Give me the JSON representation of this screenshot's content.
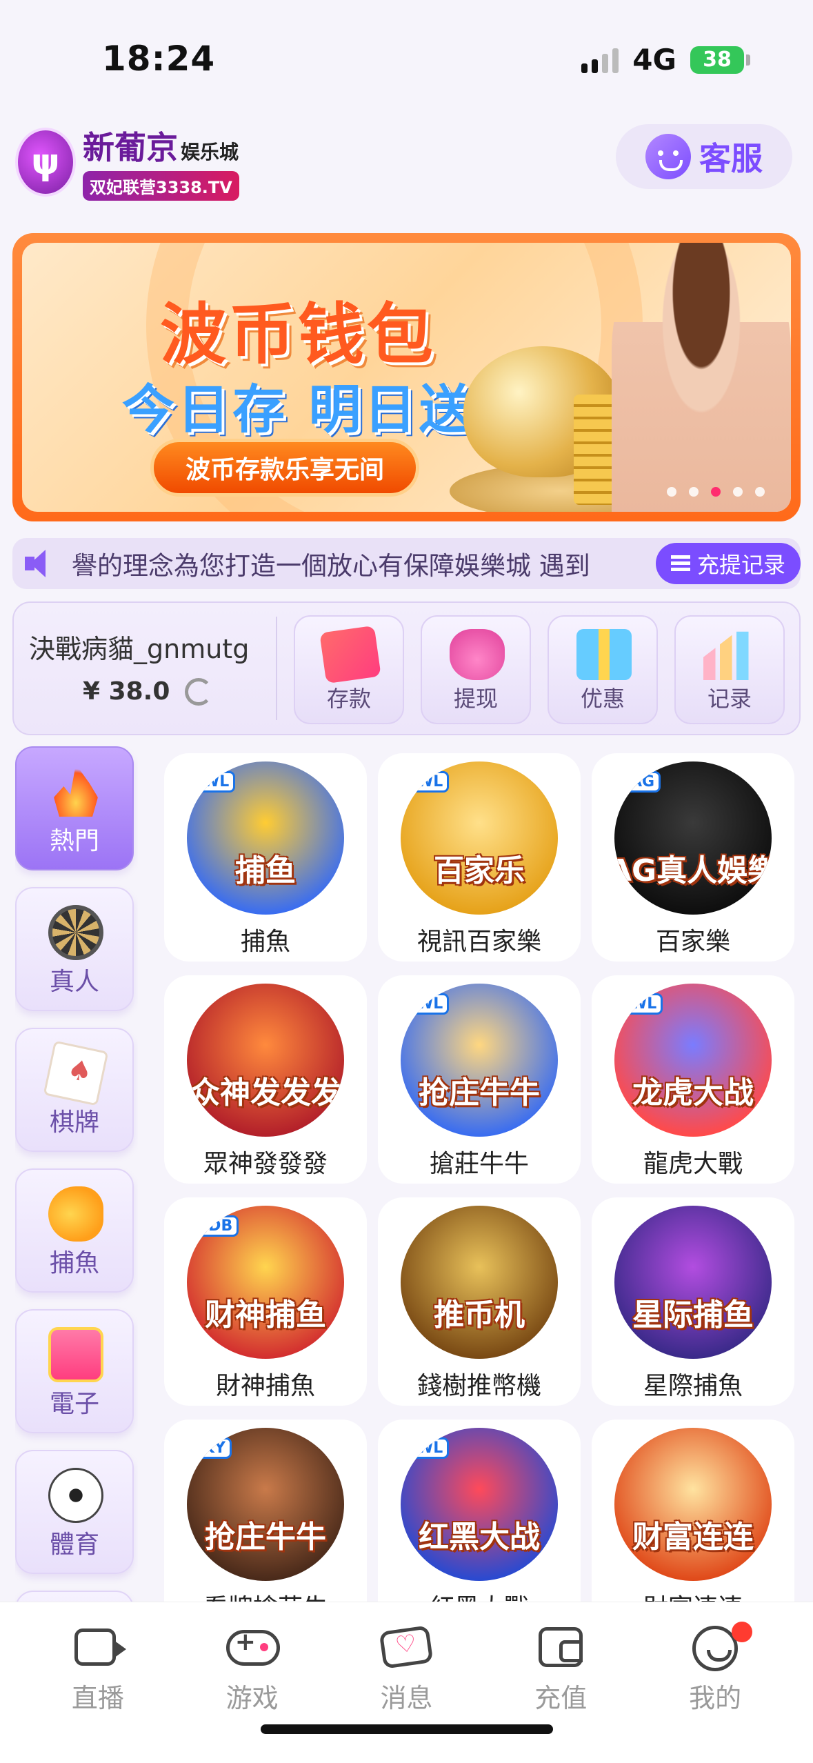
{
  "status_bar": {
    "time": "18:24",
    "network": "4G",
    "battery": "38"
  },
  "header": {
    "logo_name": "新葡京",
    "logo_sub": "娱乐城",
    "logo_badge": "双妃联营3338.TV",
    "service_label": "客服",
    "service_icon": "headset-icon"
  },
  "banner": {
    "title": "波币钱包",
    "subtitle": "今日存 明日送",
    "button": "波币存款乐享无间",
    "dots": 5,
    "active_dot": 3
  },
  "marquee": {
    "text": "譽的理念為您打造一個放心有保障娛樂城 遇到",
    "withdraw_log": "充提记录"
  },
  "account": {
    "username": "決戰病貓_gnmutg",
    "balance": "¥ 38.0",
    "actions": [
      {
        "label": "存款",
        "icon": "card-icon"
      },
      {
        "label": "提现",
        "icon": "money-bag-icon"
      },
      {
        "label": "优惠",
        "icon": "gift-icon"
      },
      {
        "label": "记录",
        "icon": "bar-chart-icon"
      }
    ]
  },
  "categories": [
    {
      "label": "熱門",
      "icon": "fire-icon",
      "active": true
    },
    {
      "label": "真人",
      "icon": "poker-chip-icon"
    },
    {
      "label": "棋牌",
      "icon": "playing-card-icon"
    },
    {
      "label": "捕魚",
      "icon": "fish-icon"
    },
    {
      "label": "電子",
      "icon": "slot-machine-icon"
    },
    {
      "label": "體育",
      "icon": "soccer-ball-icon"
    }
  ],
  "games": [
    {
      "label": "捕魚",
      "art": "捕鱼",
      "tag": "WL",
      "color1": "#ffcc33",
      "color2": "#3a6df0"
    },
    {
      "label": "視訊百家樂",
      "art": "百家乐",
      "tag": "WL",
      "color1": "#ffe08a",
      "color2": "#e6a21a"
    },
    {
      "label": "百家樂",
      "art": "AG真人娛樂",
      "tag": "AG",
      "color1": "#3a3a3a",
      "color2": "#0e0e0e"
    },
    {
      "label": "眾神發發發",
      "art": "众神发发发",
      "tag": "",
      "color1": "#ff8a3d",
      "color2": "#b3202a"
    },
    {
      "label": "搶莊牛牛",
      "art": "抢庄牛牛",
      "tag": "WL",
      "color1": "#ffd780",
      "color2": "#3a6df0"
    },
    {
      "label": "龍虎大戰",
      "art": "龙虎大战",
      "tag": "WL",
      "color1": "#7a7cff",
      "color2": "#ff4a4a"
    },
    {
      "label": "財神捕魚",
      "art": "财神捕鱼",
      "tag": "JDB",
      "color1": "#ffd54f",
      "color2": "#d32f2f"
    },
    {
      "label": "錢樹推幣機",
      "art": "推币机",
      "tag": "",
      "color1": "#e8c15a",
      "color2": "#7a4a14"
    },
    {
      "label": "星際捕魚",
      "art": "星际捕鱼",
      "tag": "",
      "color1": "#b24de0",
      "color2": "#3b2a8a"
    },
    {
      "label": "看牌搶莊牛",
      "art": "抢庄牛牛",
      "tag": "KY",
      "color1": "#c97a4a",
      "color2": "#4a2a1a"
    },
    {
      "label": "紅黑大戰",
      "art": "红黑大战",
      "tag": "WL",
      "color1": "#ff4a5a",
      "color2": "#2a4ad0"
    },
    {
      "label": "財富連連",
      "art": "财富连连",
      "tag": "",
      "color1": "#ffe3a0",
      "color2": "#e04a1a"
    }
  ],
  "tabbar": [
    {
      "label": "直播",
      "icon": "live-camera-icon"
    },
    {
      "label": "游戏",
      "icon": "gamepad-icon"
    },
    {
      "label": "消息",
      "icon": "message-icon"
    },
    {
      "label": "充值",
      "icon": "wallet-icon"
    },
    {
      "label": "我的",
      "icon": "profile-icon",
      "badge": true
    }
  ]
}
